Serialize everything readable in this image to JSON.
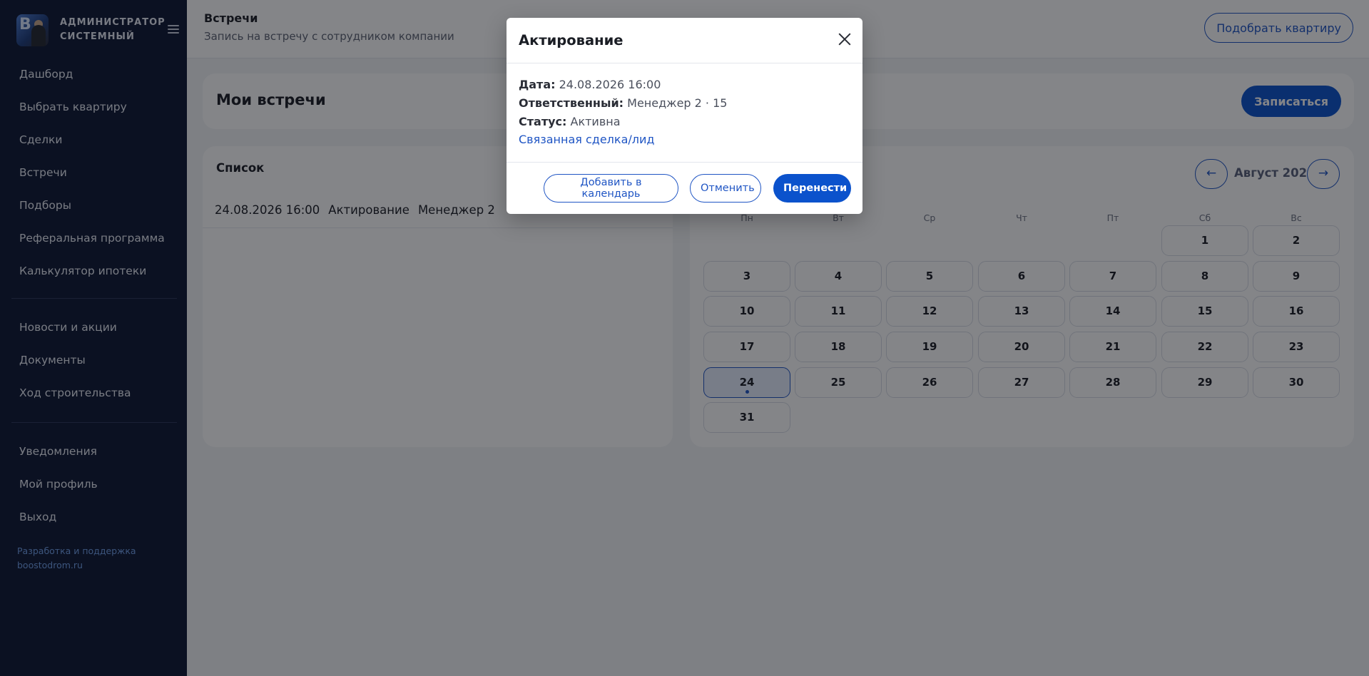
{
  "sidebar": {
    "profile_name": "АДМИНИСТРАТОР СИСТЕМНЫЙ",
    "avatar_initials": "В",
    "menu_primary": [
      "Дашборд",
      "Выбрать квартиру",
      "Сделки",
      "Встречи",
      "Подборы",
      "Реферальная программа",
      "Калькулятор ипотеки"
    ],
    "menu_secondary": [
      "Новости и акции",
      "Документы",
      "Ход строительства"
    ],
    "menu_tertiary": [
      "Уведомления",
      "Мой профиль",
      "Выход"
    ],
    "footer_line1": "Разработка и поддержка",
    "footer_line2": "boostodrom.ru"
  },
  "header": {
    "title": "Встречи",
    "subtitle": "Запись на встречу с сотрудником компании",
    "pick_button": "Подобрать квартиру"
  },
  "my_meetings": {
    "title": "Мои встречи",
    "signup_button": "Записаться"
  },
  "list": {
    "title": "Список",
    "rows": [
      {
        "datetime": "24.08.2026 16:00",
        "type": "Актирование",
        "manager": "Менеджер 2"
      }
    ]
  },
  "calendar": {
    "prev_button": "←",
    "next_button": "→",
    "month_label": "Август 2026",
    "weekdays": [
      "Пн",
      "Вт",
      "Ср",
      "Чт",
      "Пт",
      "Сб",
      "Вс"
    ],
    "first_weekday_index": 5,
    "days_in_month": 31,
    "selected_day": 24,
    "event_days": [
      24
    ]
  },
  "modal": {
    "title": "Актирование",
    "date_label": "Дата:",
    "date_value": "24.08.2026 16:00",
    "responsible_label": "Ответственный:",
    "responsible_value": "Менеджер 2 · 15",
    "status_label": "Статус:",
    "status_value": "Активна",
    "deal_link": "Связанная сделка/лид",
    "add_calendar_button": "Добавить в календарь",
    "cancel_button": "Отменить",
    "reschedule_button": "Перенести"
  },
  "colors": {
    "sidebar_bg": "#0d1633",
    "accent": "#0b52cc",
    "link": "#1f55c4",
    "overlay": "rgba(10,12,18,0.5)"
  }
}
